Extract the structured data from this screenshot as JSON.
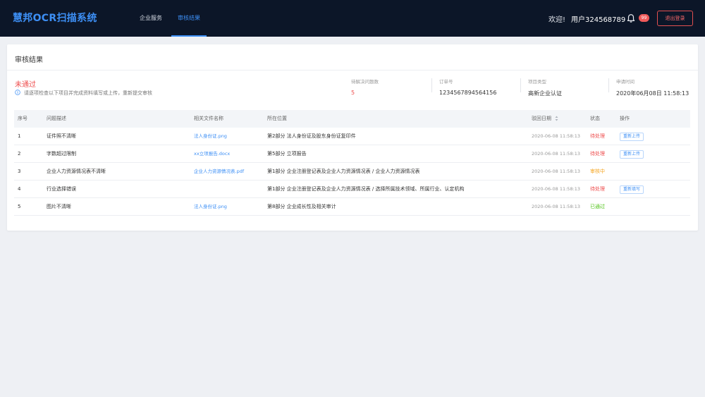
{
  "header": {
    "logo": "慧邦OCR扫描系统",
    "nav": [
      {
        "label": "企业服务",
        "active": false
      },
      {
        "label": "审核结果",
        "active": true
      }
    ],
    "welcome": "欢迎!",
    "username": "用户324568789",
    "notification_count": "99",
    "logout_label": "退出登录"
  },
  "card": {
    "title": "审核结果",
    "status": "未通过",
    "hint": "请逐项检查以下项目并完成资料填写或上传，重新提交审核",
    "stats": [
      {
        "label": "待解决问题数",
        "value": "5"
      },
      {
        "label": "订单号",
        "value": "1234567894564156"
      },
      {
        "label": "项目类型",
        "value": "高新企业认证"
      },
      {
        "label": "申请时间",
        "value": "2020年06月08日 11:58:13"
      }
    ]
  },
  "table": {
    "headers": [
      "序号",
      "问题描述",
      "相关文件名称",
      "所在位置",
      "驳回日期",
      "状态",
      "操作"
    ],
    "rows": [
      {
        "no": "1",
        "desc": "证件照不清晰",
        "file": "法人身份证.png",
        "location": "第2部分 法人身份证及股东身份证复印件",
        "date": "2020-06-08 11:58:13",
        "status": "待处理",
        "action": "重新上传"
      },
      {
        "no": "2",
        "desc": "字数超过限制",
        "file": "xx立项报告.docx",
        "location": "第5部分 立项报告",
        "date": "2020-06-08 11:58:13",
        "status": "待处理",
        "action": "重新上传"
      },
      {
        "no": "3",
        "desc": "企业人力资源情况表不清晰",
        "file": "企业人力资源情况表.pdf",
        "location": "第1部分 企业注册登记表及企业人力资源情况表 / 企业人力资源情况表",
        "date": "2020-06-08 11:58:13",
        "status": "审核中",
        "action": ""
      },
      {
        "no": "4",
        "desc": "行业选择错误",
        "file": "",
        "location": "第1部分 企业注册登记表及企业人力资源情况表 / 选择所属技术领域、所属行业、认定机构",
        "date": "2020-06-08 11:58:13",
        "status": "待处理",
        "action": "重新填写"
      },
      {
        "no": "5",
        "desc": "图片不清晰",
        "file": "法人身份证.png",
        "location": "第8部分 企业成长性及相关审计",
        "date": "2020-06-08 11:58:13",
        "status": "已通过",
        "action": ""
      }
    ]
  },
  "colors": {
    "topbar": "#0c1628",
    "accent": "#3d8ff5",
    "status_pending": "#ee4d4d",
    "status_reviewing": "#f5a623",
    "status_passed": "#52c41a"
  }
}
